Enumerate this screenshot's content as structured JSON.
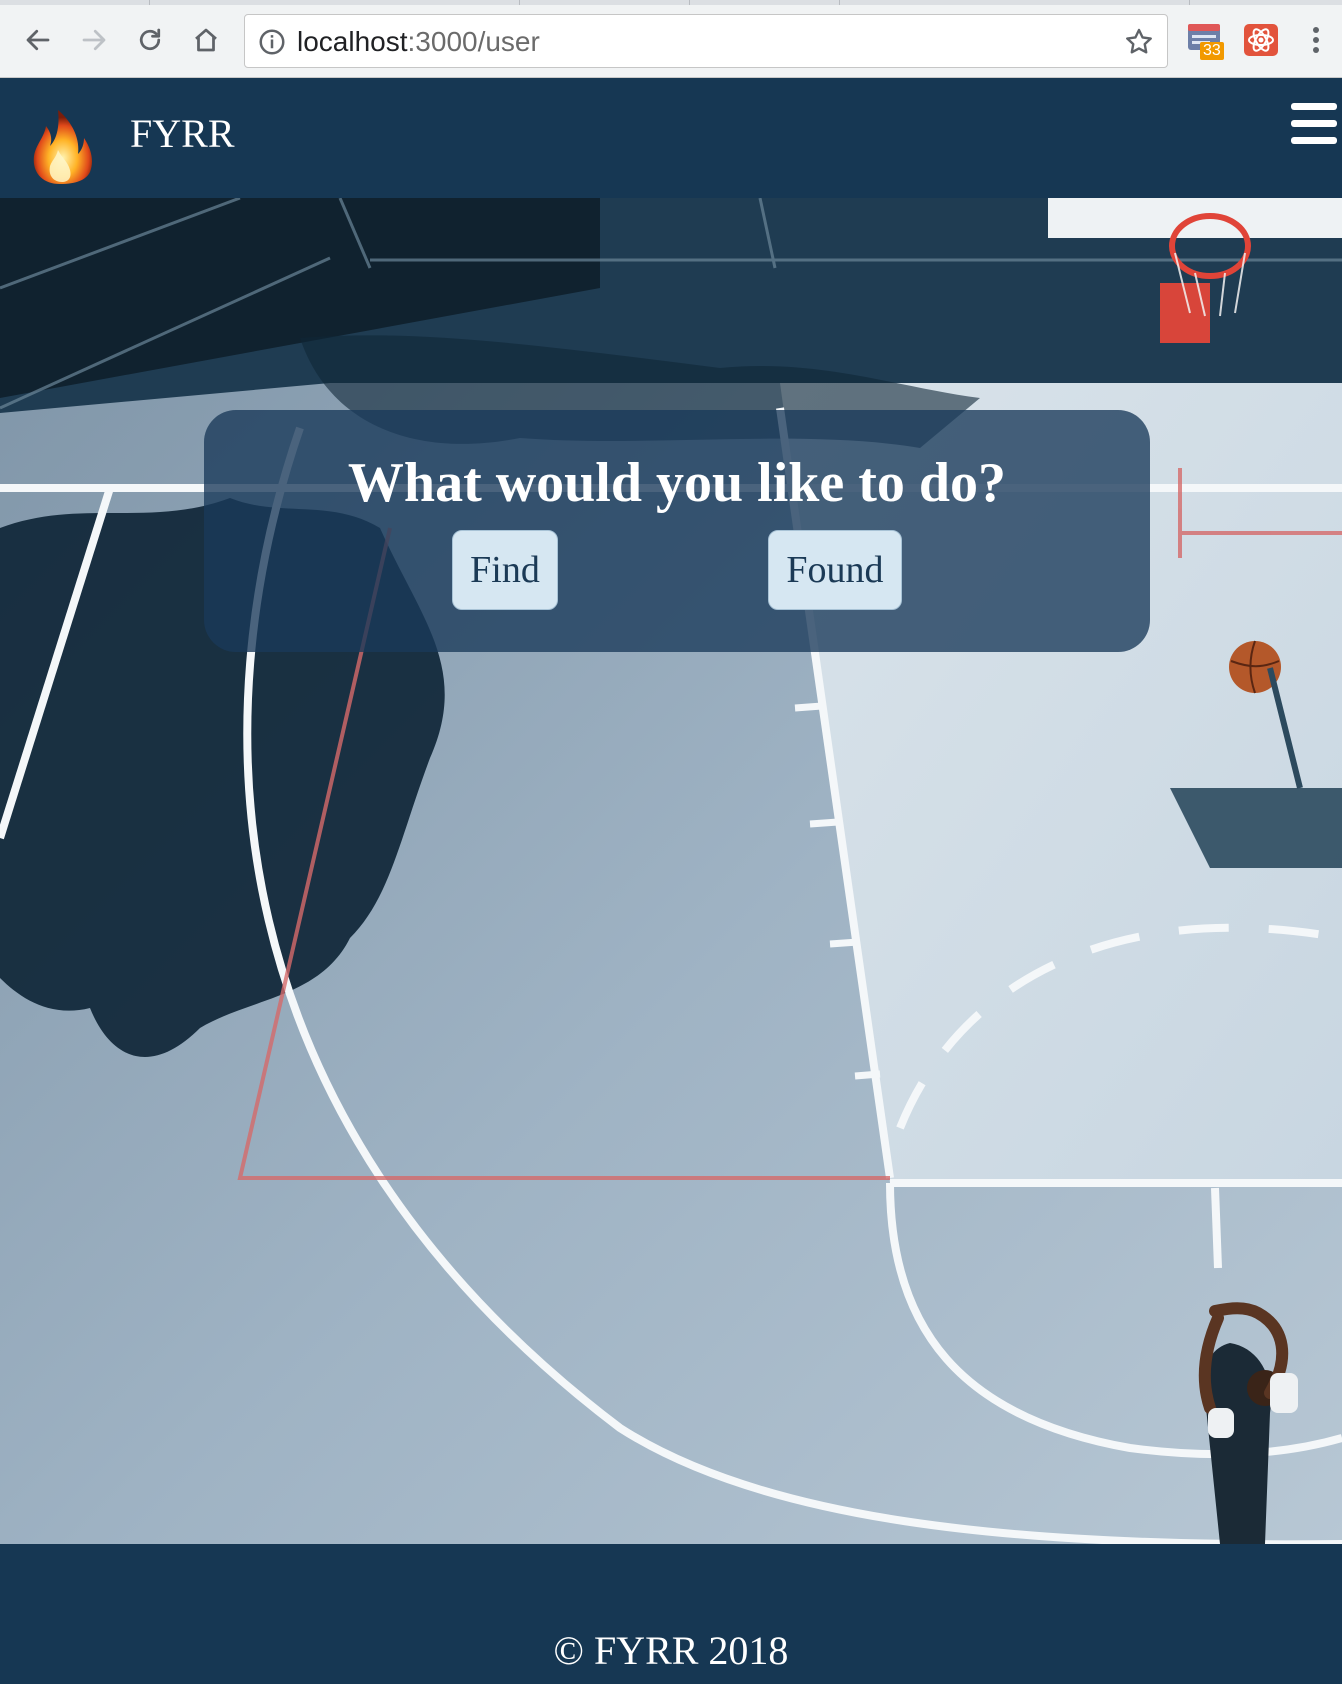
{
  "browser": {
    "url_host": "localhost",
    "url_rest": ":3000/user",
    "extension_badge": "33"
  },
  "header": {
    "brand": "FYRR"
  },
  "main": {
    "prompt": "What would you like to do?",
    "buttons": {
      "find": "Find",
      "found": "Found"
    }
  },
  "footer": {
    "copyright": "© FYRR 2018"
  },
  "colors": {
    "navbar": "#163753",
    "panel": "#193a5a",
    "button_bg": "#d6e7f2",
    "button_text": "#1b3a56"
  }
}
